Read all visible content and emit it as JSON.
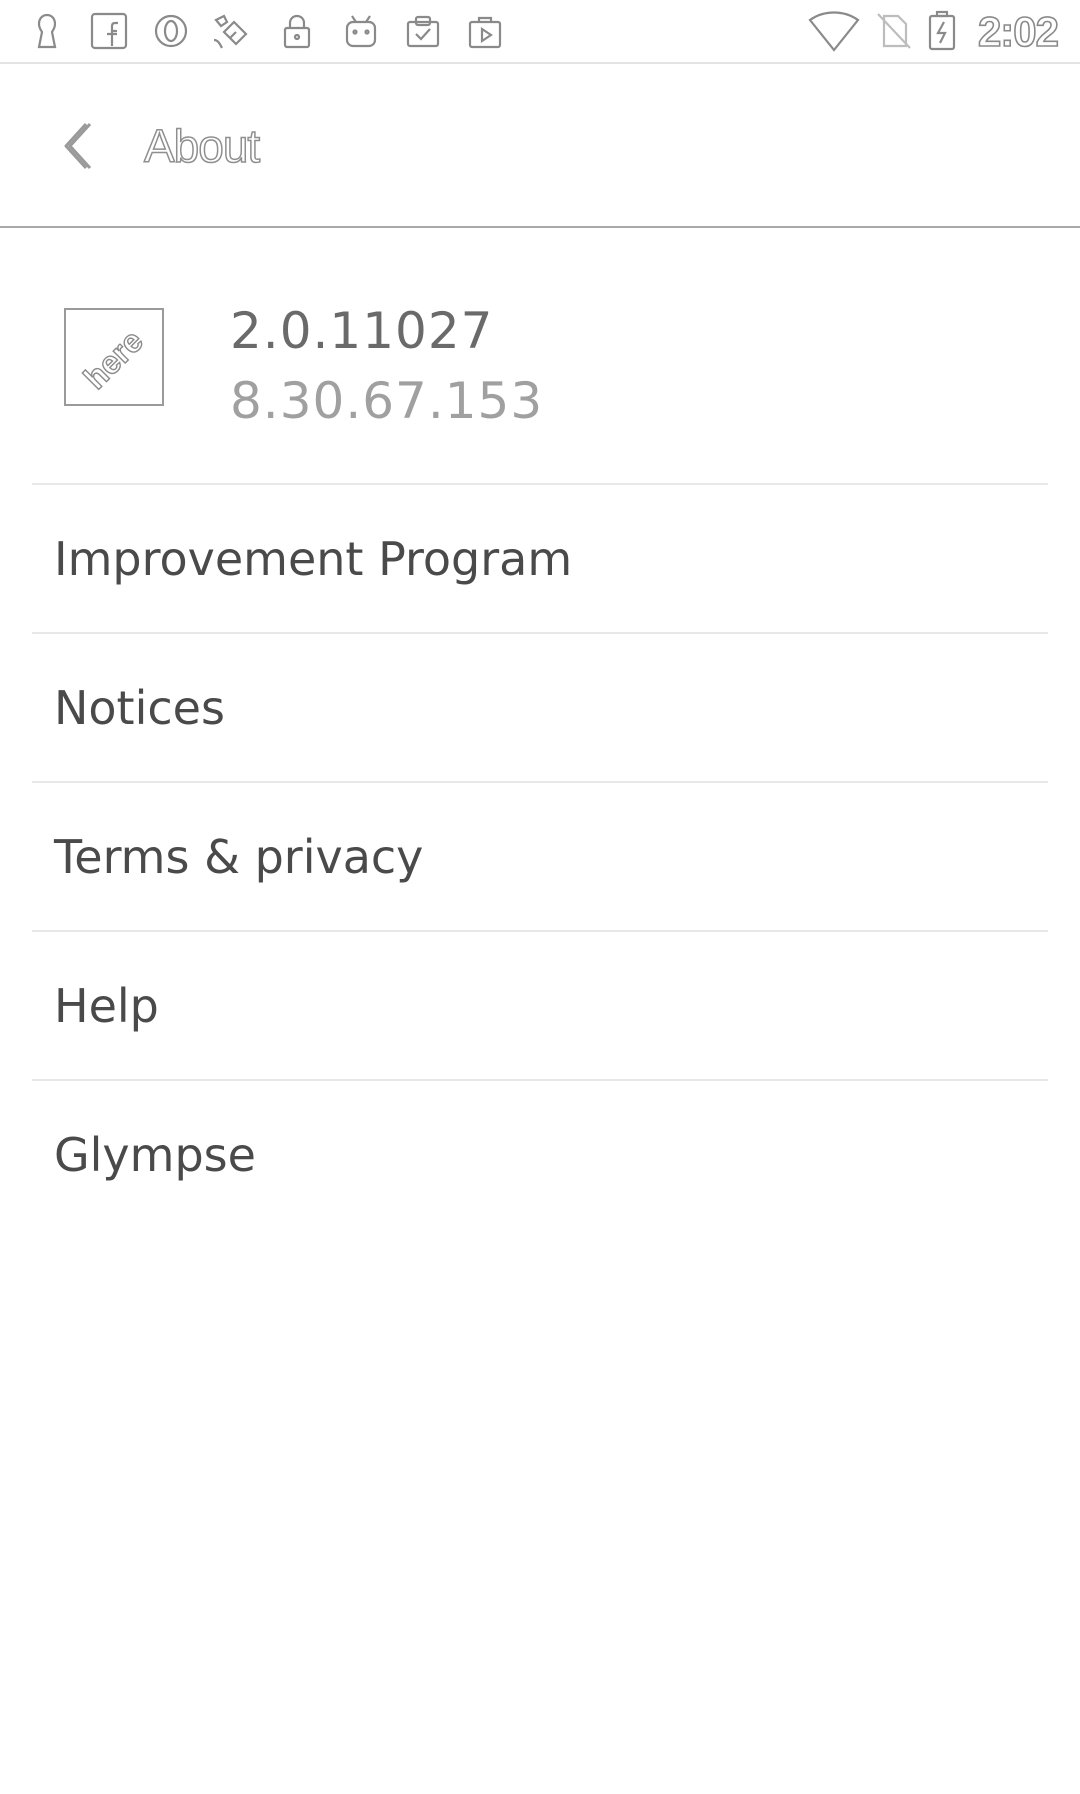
{
  "status_bar": {
    "time": "2:02",
    "left_icons": [
      "person-icon",
      "facebook-icon",
      "opera-icon",
      "game-icon",
      "lock-icon",
      "android-icon",
      "clipboard-check-icon",
      "media-store-icon"
    ],
    "right_icons": [
      "wifi-icon",
      "no-sim-icon",
      "battery-charging-icon"
    ]
  },
  "header": {
    "title": "About",
    "back_icon": "chevron-left-icon"
  },
  "app_info": {
    "logo_text": "here",
    "version": "2.0.11027",
    "build": "8.30.67.153"
  },
  "menu": {
    "items": [
      {
        "label": "Improvement Program"
      },
      {
        "label": "Notices"
      },
      {
        "label": "Terms & privacy"
      },
      {
        "label": "Help"
      },
      {
        "label": "Glympse"
      }
    ]
  },
  "colors": {
    "divider": "#e8e8e8",
    "header_border": "#a9a9a9",
    "text": "#4a4a4a",
    "secondary_text": "#a0a0a0"
  }
}
